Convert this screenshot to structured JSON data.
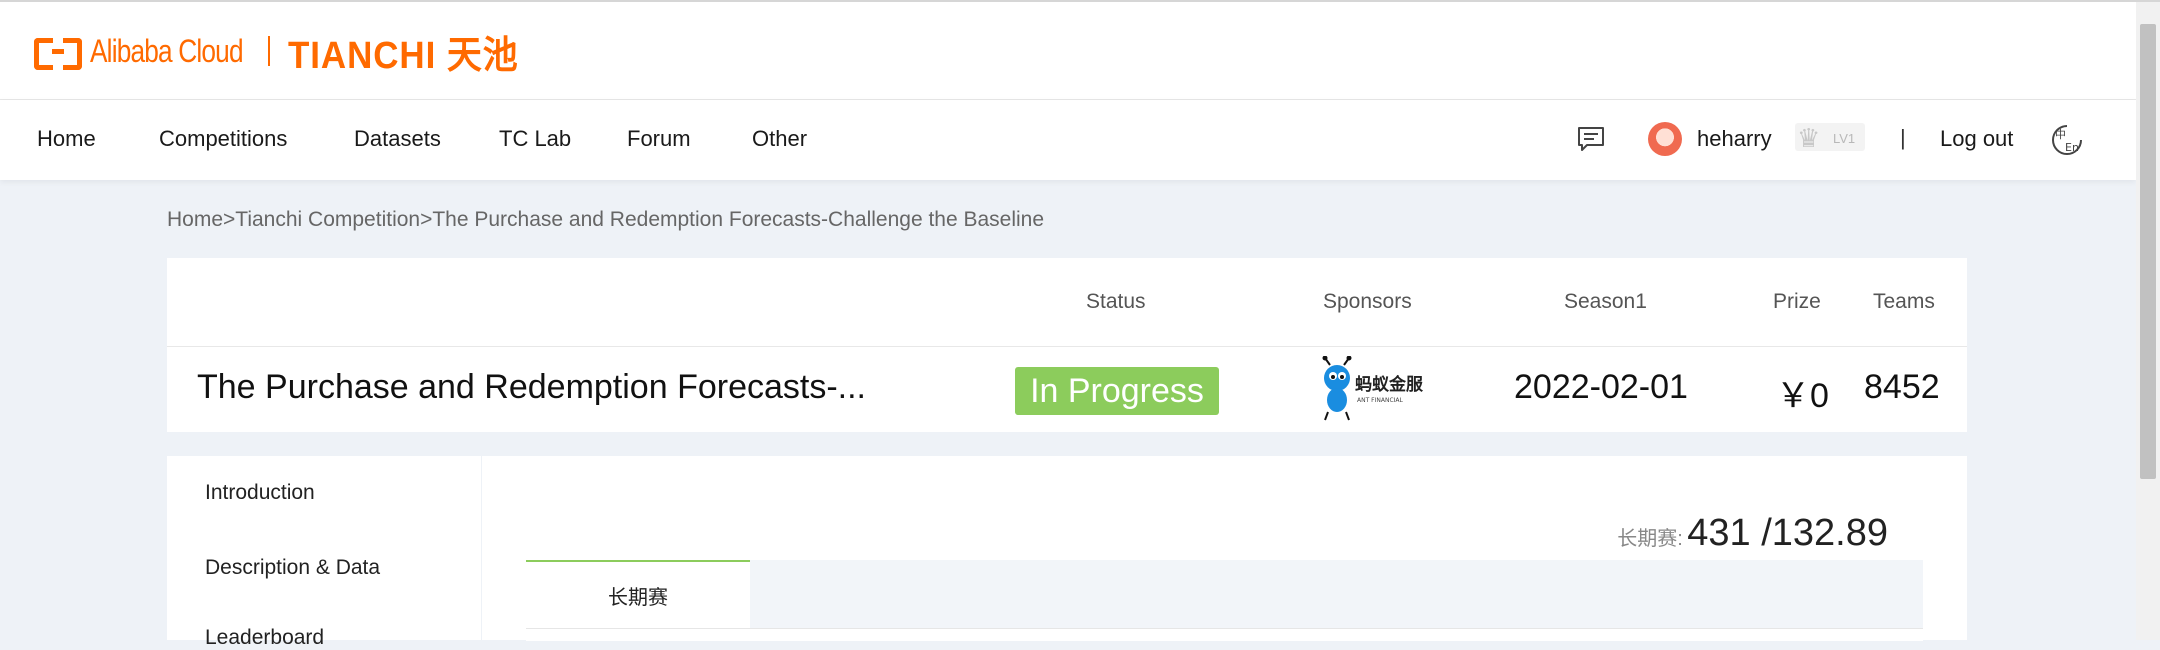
{
  "header": {
    "brand": "Alibaba Cloud",
    "tianchi": "TIANCHI 天池"
  },
  "nav": {
    "items": [
      "Home",
      "Competitions",
      "Datasets",
      "TC Lab",
      "Forum",
      "Other"
    ],
    "username": "heharry",
    "level": "LV1",
    "separator": "|",
    "logout": "Log out",
    "icons": [
      "message-icon",
      "crown-icon",
      "language-switch-icon"
    ]
  },
  "breadcrumb": "Home>Tianchi Competition>The Purchase and Redemption Forecasts-Challenge the Baseline",
  "competition": {
    "headers": {
      "status": "Status",
      "sponsors": "Sponsors",
      "season": "Season1",
      "prize": "Prize",
      "teams": "Teams"
    },
    "title": "The Purchase and Redemption Forecasts-...",
    "status": "In Progress",
    "sponsor_text": "蚂蚁金服",
    "sponsor_subtext": "ANT FINANCIAL",
    "season_date": "2022-02-01",
    "prize": "￥0",
    "teams": "8452"
  },
  "sidebar": {
    "items": [
      "Introduction",
      "Description & Data",
      "Leaderboard"
    ]
  },
  "main": {
    "score_label": "长期赛:",
    "score_value": "431 /132.89",
    "tabs": [
      "长期赛"
    ]
  },
  "colors": {
    "brand": "#ff6a00",
    "status_green": "#8ccc5c",
    "page_bg": "#eef2f7"
  }
}
